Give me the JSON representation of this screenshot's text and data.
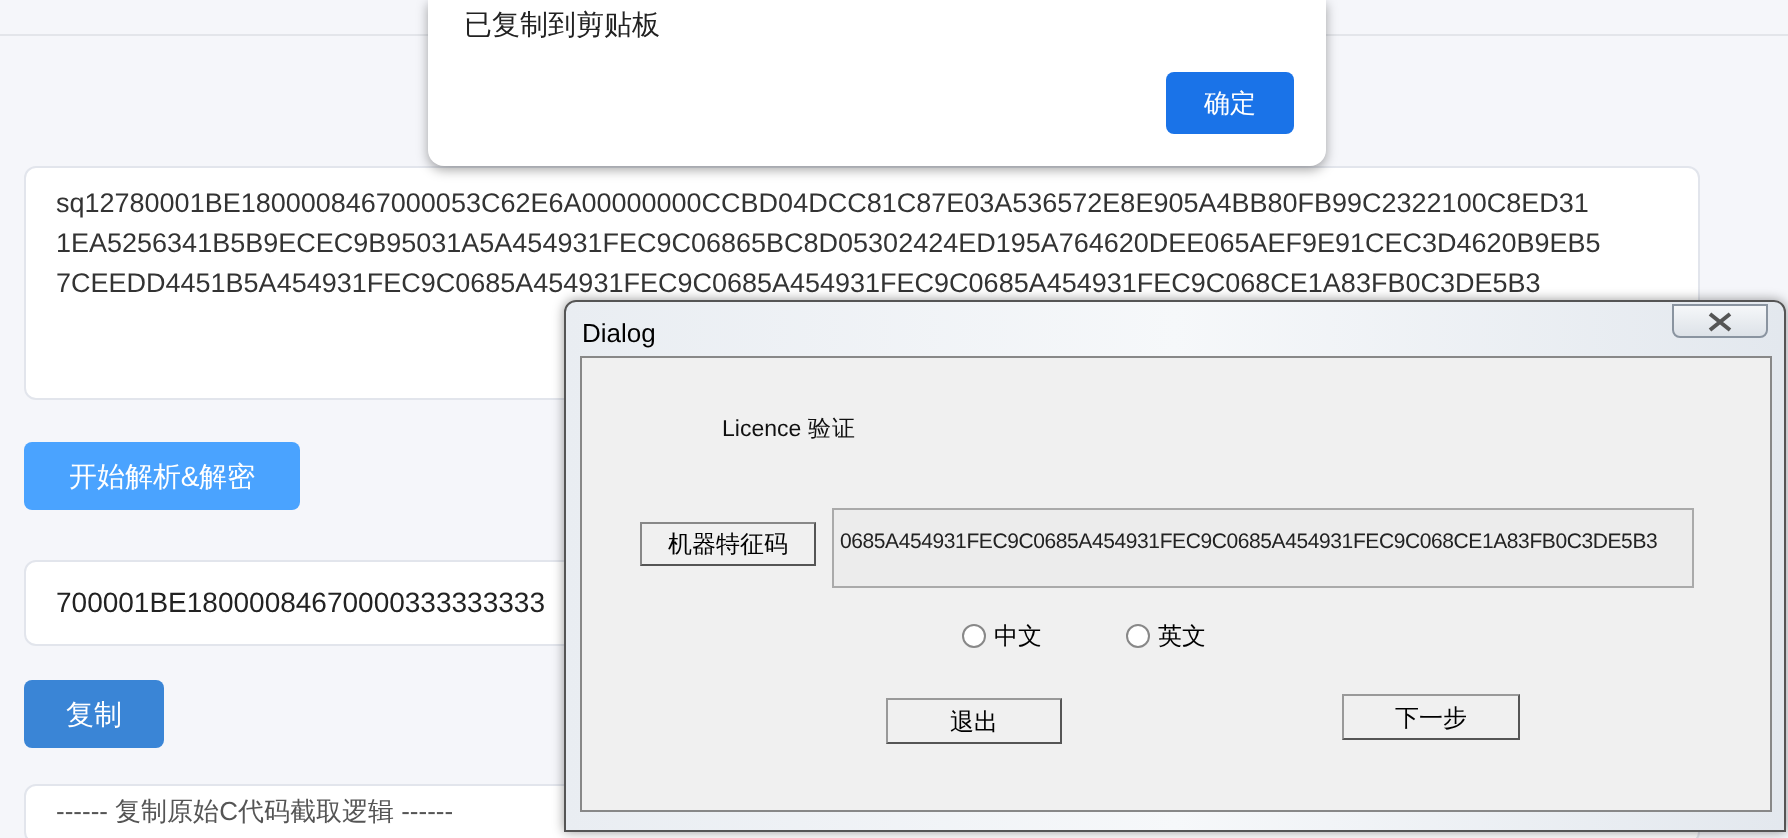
{
  "page": {
    "source_lines": [
      "sq12780001BE1800008467000053C62E6A00000000CCBD04DCC81C87E03A536572E8E905A4BB80FB99C2322100C8ED31",
      "1EA5256341B5B9ECEC9B95031A5A454931FEC9C06865BC8D05302424ED195A764620DEE065AEF9E91CEC3D4620B9EB5",
      "7CEEDD4451B5A454931FEC9C0685A454931FEC9C0685A454931FEC9C0685A454931FEC9C068CE1A83FB0C3DE5B3"
    ],
    "parse_button": "开始解析&解密",
    "result_value": "700001BE18000084670000333333333",
    "copy_button": "复制",
    "section_heading": "------ 复制原始C代码截取逻辑 ------"
  },
  "alert": {
    "message": "已复制到剪贴板",
    "ok_button": "确定"
  },
  "dialog": {
    "title": "Dialog",
    "heading": "Licence 验证",
    "machine_code_button": "机器特征码",
    "machine_code": "0685A454931FEC9C0685A454931FEC9C0685A454931FEC9C068CE1A83FB0C3DE5B3",
    "languages": [
      {
        "label": "中文",
        "selected": false
      },
      {
        "label": "英文",
        "selected": false
      }
    ],
    "exit_button": "退出",
    "next_button": "下一步"
  }
}
